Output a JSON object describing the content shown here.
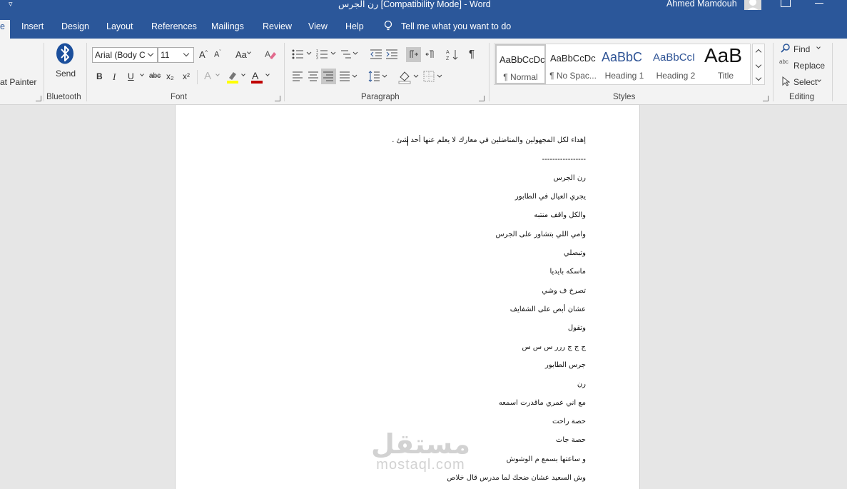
{
  "titlebar": {
    "document_title": "رن الجرس [Compatibility Mode]  -  Word",
    "user_name": "Ahmed Mamdouh"
  },
  "tabs": {
    "active_partial": "e",
    "items": [
      "Insert",
      "Design",
      "Layout",
      "References",
      "Mailings",
      "Review",
      "View",
      "Help"
    ],
    "tell_me": "Tell me what you want to do"
  },
  "ribbon": {
    "clipboard": {
      "format_painter": "at Painter"
    },
    "bluetooth": {
      "send_label": "Send",
      "group_label": "Bluetooth"
    },
    "font": {
      "font_name": "Arial (Body C",
      "font_size": "11",
      "change_case": "Aa",
      "bold": "B",
      "italic": "I",
      "underline": "U",
      "strikethrough": "abc",
      "subscript": "x₂",
      "superscript": "x²",
      "text_effects": "A",
      "font_color_label": "A",
      "group_label": "Font"
    },
    "paragraph": {
      "group_label": "Paragraph",
      "pilcrow": "¶"
    },
    "styles": {
      "group_label": "Styles",
      "items": [
        {
          "sample": "AaBbCcDc",
          "name": "¶ Normal"
        },
        {
          "sample": "AaBbCcDc",
          "name": "¶ No Spac..."
        },
        {
          "sample": "AaBbC",
          "name": "Heading 1"
        },
        {
          "sample": "AaBbCcI",
          "name": "Heading 2"
        },
        {
          "sample": "AaB",
          "name": "Title"
        }
      ]
    },
    "editing": {
      "group_label": "Editing",
      "find": "Find",
      "replace": "Replace",
      "select": "Select",
      "replace_icon_text": "abc"
    }
  },
  "document": {
    "lines": [
      "إهداء لكل المجهولين والمناضلين في معارك لا يعلم عنها أحد شئ .",
      "-----------------",
      "رن الجرس",
      "يجري العيال في الطابور",
      "والكل واقف منتبه",
      "وامي اللي بتشاور على الجرس",
      "وتبصلي",
      "ماسكه بايديا",
      "تصرخ ف وشي",
      "عشان أبص على الشفايف",
      "وتقول",
      "ج ج ج  ررر س س س",
      "جرس الطابور",
      "رن",
      "مع اني عمري ماقدرت اسمعه",
      "حصة راحت",
      "حصة جات",
      "و ساعتها بسمع م الوشوش",
      "وش السعيد عشان ضحك لما مدرس قال خلاص"
    ]
  },
  "watermark": {
    "arabic": "مستقل",
    "latin": "mostaql.com"
  }
}
